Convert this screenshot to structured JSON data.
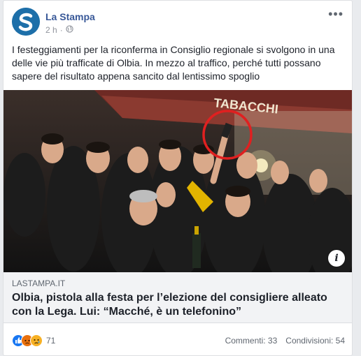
{
  "post": {
    "page_name": "La Stampa",
    "time": "2 h",
    "separator": "·",
    "body_text": "I festeggiamenti per la riconferma in Consiglio regionale si svolgono in una delle vie più trafficate di Olbia. In mezzo al traffico, perché tutti possano sapere del risultato appena sancito dal lentissimo spoglio",
    "more_label": "•••",
    "image_sign_text": "TABACCHI",
    "link": {
      "domain": "LASTAMPA.IT",
      "headline": "Olbia, pistola alla festa per l’elezione del consigliere alleato con la Lega. Lui: “Macché, è un telefonino”"
    },
    "footer": {
      "reaction_count": "71",
      "comments": "Commenti: 33",
      "shares": "Condivisioni: 54"
    }
  },
  "icons": {
    "avatar": "la-stampa-logo-icon",
    "privacy": "globe-icon",
    "options": "more-options-icon",
    "info": "info-icon",
    "reactions": [
      "like-icon",
      "angry-icon",
      "sad-icon"
    ]
  },
  "colors": {
    "brand_blue": "#385898",
    "logo_blue": "#1d6fa9",
    "highlight_circle": "#e02020",
    "like": "#1877f2",
    "angry": "#e9710f",
    "sad": "#f7b125"
  }
}
